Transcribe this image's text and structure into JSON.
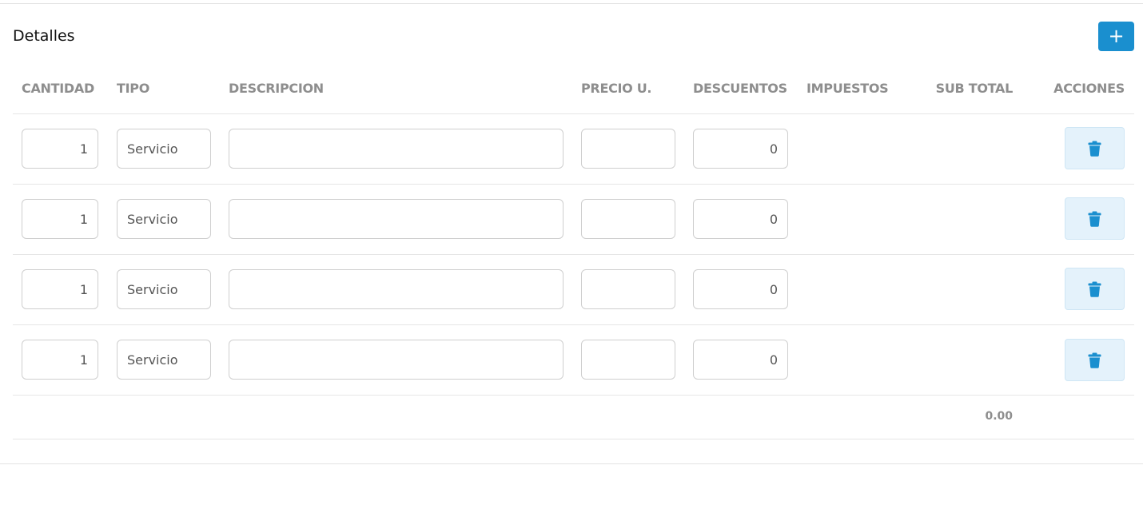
{
  "section": {
    "title": "Detalles",
    "add_label": "+"
  },
  "columns": {
    "cantidad": "CANTIDAD",
    "tipo": "TIPO",
    "descripcion": "DESCRIPCION",
    "precio": "PRECIO U.",
    "descuentos": "DESCUENTOS",
    "impuestos": "IMPUESTOS",
    "subtotal": "SUB TOTAL",
    "acciones": "ACCIONES"
  },
  "rows": [
    {
      "cantidad": "1",
      "tipo": "Servicio",
      "descripcion": "",
      "precio": "",
      "descuentos": "0"
    },
    {
      "cantidad": "1",
      "tipo": "Servicio",
      "descripcion": "",
      "precio": "",
      "descuentos": "0"
    },
    {
      "cantidad": "1",
      "tipo": "Servicio",
      "descripcion": "",
      "precio": "",
      "descuentos": "0"
    },
    {
      "cantidad": "1",
      "tipo": "Servicio",
      "descripcion": "",
      "precio": "",
      "descuentos": "0"
    }
  ],
  "totals": {
    "subtotal": "0.00"
  },
  "colors": {
    "accent": "#1a8fcf",
    "delete_bg": "#e4f2fb",
    "header_text": "#8e8e8e"
  },
  "icons": {
    "add": "plus-icon",
    "delete": "trash-icon"
  }
}
